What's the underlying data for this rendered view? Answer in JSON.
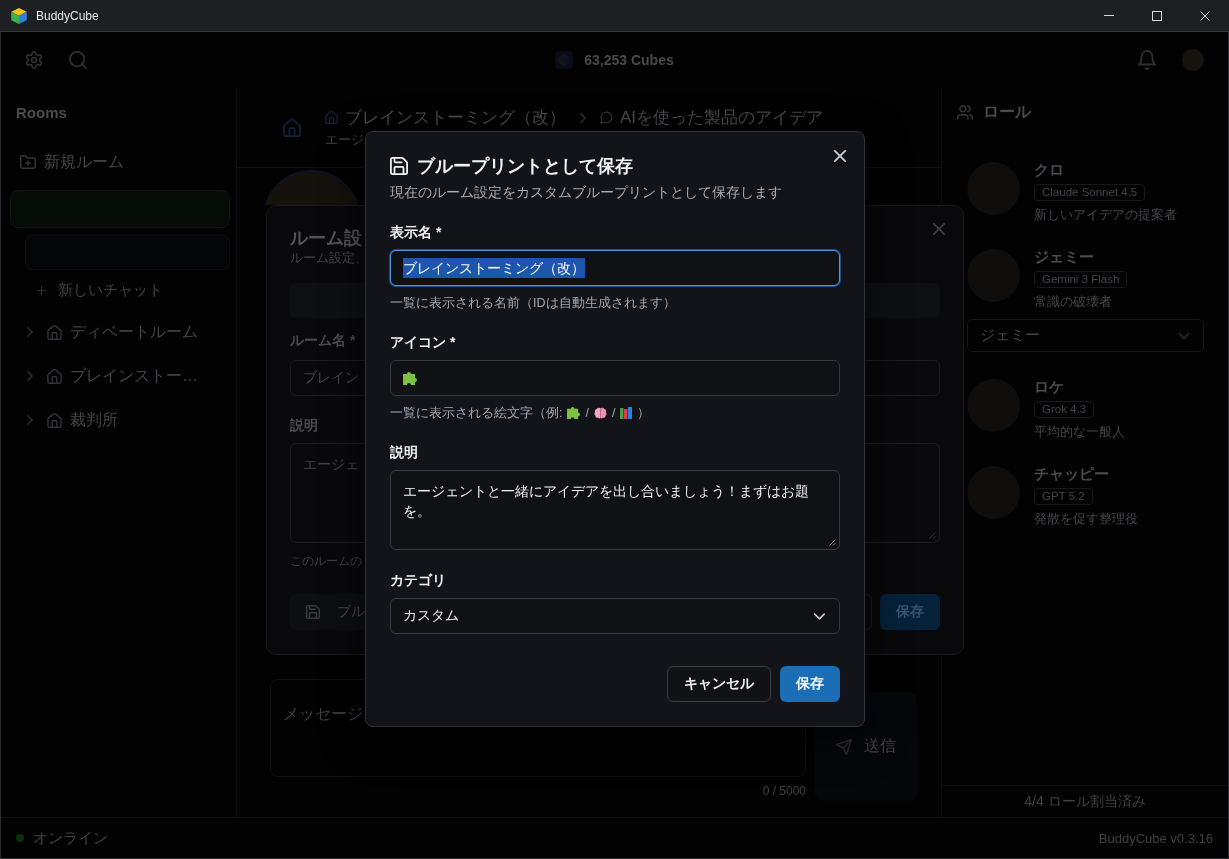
{
  "window": {
    "title": "BuddyCube"
  },
  "top_bar": {
    "balance": "63,253 Cubes"
  },
  "sidebar": {
    "heading": "Rooms",
    "new_room": "新規ルーム",
    "new_chat": "新しいチャット",
    "rooms": [
      {
        "label": "ディベートルーム",
        "expanded": false
      },
      {
        "label": "ブレインストー…",
        "expanded": false
      },
      {
        "label": "裁判所",
        "expanded": false
      }
    ]
  },
  "chat": {
    "room": "ブレインストーミング（改）",
    "topic": "AIを使った製品のアイデア",
    "subtitle": "エージ",
    "composer": {
      "placeholder": "メッセージ",
      "counter": "0 / 5000",
      "send": "送信"
    }
  },
  "roles_panel": {
    "title": "ロール",
    "roles": [
      {
        "name": "クロ",
        "model": "Claude Sonnet 4.5",
        "description": "新しいアイデアの提案者"
      },
      {
        "name": "ジェミー",
        "model": "Gemini 3 Flash",
        "description": "常識の破壊者",
        "agent_select": "ジェミー"
      },
      {
        "name": "ロケ",
        "model": "Grok 4.3",
        "description": "平均的な一般人"
      },
      {
        "name": "チャッピー",
        "model": "GPT 5.2",
        "description": "発散を促す整理役"
      }
    ],
    "footer": "4/4 ロール割当済み"
  },
  "status_bar": {
    "status": "オンライン",
    "online": true,
    "version": "BuddyCube v0.3.16"
  },
  "room_settings_dialog": {
    "title": "ルーム設",
    "subtitle": "ルーム設定、",
    "name_label": "ルーム名 *",
    "name_value": "ブレイン",
    "description_label": "説明",
    "description_value": "エージェ",
    "hint": "このルームの",
    "blueprint_button": "ブル",
    "save_button": "保存"
  },
  "blueprint_dialog": {
    "title": "ブループリントとして保存",
    "subtitle": "現在のルーム設定をカスタムブループリントとして保存します",
    "fields": [
      {
        "kind": "text",
        "label": "表示名 *",
        "value": "ブレインストーミング（改）",
        "focused": true,
        "text_selected": true,
        "hint": "一覧に表示される名前（IDは自動生成されます）"
      },
      {
        "kind": "emoji",
        "label": "アイコン *",
        "focused": false,
        "hint_parts": [
          "一覧に表示される絵文字（例:",
          "/",
          "/",
          "）"
        ]
      },
      {
        "kind": "textarea",
        "label": "説明",
        "value": "エージェントと一緒にアイデアを出し合いましょう！まずはお題を。",
        "focused": false
      },
      {
        "kind": "select",
        "label": "カテゴリ",
        "value": "カスタム",
        "focused": false
      }
    ],
    "buttons": [
      {
        "label": "キャンセル",
        "kind": "secondary"
      },
      {
        "label": "保存",
        "kind": "primary"
      }
    ]
  }
}
